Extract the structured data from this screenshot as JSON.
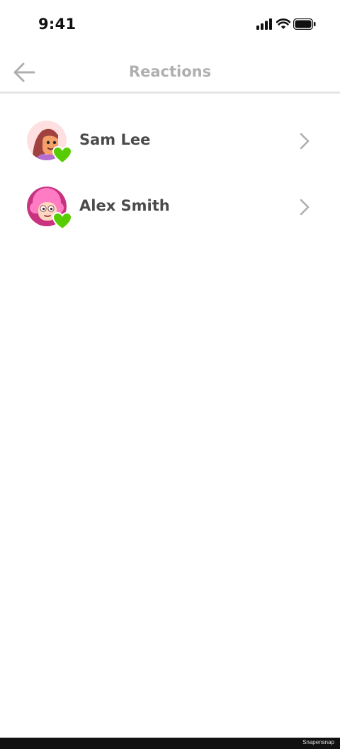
{
  "status_bar": {
    "time": "9:41"
  },
  "header": {
    "title": "Reactions"
  },
  "reactions": [
    {
      "name": "Sam Lee",
      "reaction": "heart-icon"
    },
    {
      "name": "Alex Smith",
      "reaction": "heart-icon"
    }
  ],
  "watermark": "Snapensnap",
  "colors": {
    "reaction_green": "#58cc02",
    "title_gray": "#afafaf",
    "name_text": "#4b4b4b"
  }
}
